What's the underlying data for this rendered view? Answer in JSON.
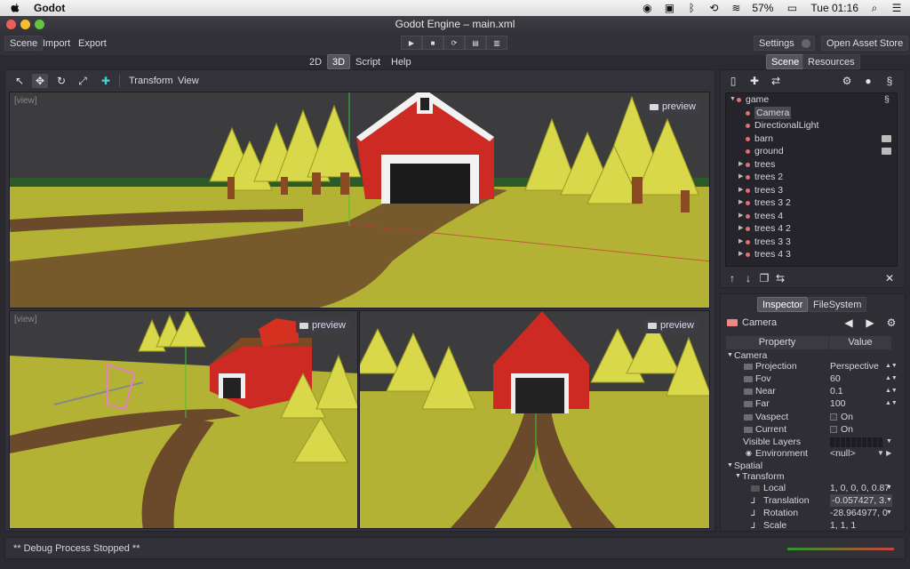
{
  "menubar": {
    "app_name": "Godot",
    "battery": "57%",
    "clock": "Tue 01:16"
  },
  "window": {
    "title": "Godot Engine – main.xml"
  },
  "topbar": {
    "scene": "Scene",
    "import": "Import",
    "export": "Export",
    "settings": "Settings",
    "asset_store": "Open Asset Store"
  },
  "mode_tabs": {
    "d2": "2D",
    "d3": "3D",
    "script": "Script",
    "help": "Help"
  },
  "vtoolbar": {
    "transform": "Transform",
    "view": "View"
  },
  "viewports": {
    "label": "[view]",
    "preview": "preview"
  },
  "scene_panel": {
    "tab_scene": "Scene",
    "tab_resources": "Resources",
    "nodes": [
      {
        "label": "game",
        "level": 0,
        "expand": "▼"
      },
      {
        "label": "Camera",
        "level": 1,
        "selected": true
      },
      {
        "label": "DirectionalLight",
        "level": 1
      },
      {
        "label": "barn",
        "level": 1
      },
      {
        "label": "ground",
        "level": 1
      },
      {
        "label": "trees",
        "level": 1,
        "expand": "▶"
      },
      {
        "label": "trees 2",
        "level": 1,
        "expand": "▶"
      },
      {
        "label": "trees 3",
        "level": 1,
        "expand": "▶"
      },
      {
        "label": "trees 3 2",
        "level": 1,
        "expand": "▶"
      },
      {
        "label": "trees 4",
        "level": 1,
        "expand": "▶"
      },
      {
        "label": "trees 4 2",
        "level": 1,
        "expand": "▶"
      },
      {
        "label": "trees 3 3",
        "level": 1,
        "expand": "▶"
      },
      {
        "label": "trees 4 3",
        "level": 1,
        "expand": "▶"
      }
    ]
  },
  "inspector": {
    "tab_inspector": "Inspector",
    "tab_filesystem": "FileSystem",
    "object": "Camera",
    "col_property": "Property",
    "col_value": "Value",
    "section_camera": "Camera",
    "projection": {
      "name": "Projection",
      "value": "Perspective"
    },
    "fov": {
      "name": "Fov",
      "value": "60"
    },
    "near": {
      "name": "Near",
      "value": "0.1"
    },
    "far": {
      "name": "Far",
      "value": "100"
    },
    "vaspect": {
      "name": "Vaspect",
      "value": "On"
    },
    "current": {
      "name": "Current",
      "value": "On"
    },
    "visible_layers": {
      "name": "Visible Layers"
    },
    "environment": {
      "name": "Environment",
      "value": "<null>"
    },
    "section_spatial": "Spatial",
    "section_transform": "Transform",
    "local": {
      "name": "Local",
      "value": "1, 0, 0, 0, 0.87"
    },
    "translation": {
      "name": "Translation",
      "value": "-0.057427, 3."
    },
    "rotation": {
      "name": "Rotation",
      "value": "-28.964977, 0"
    },
    "scale": {
      "name": "Scale",
      "value": "1, 1, 1"
    }
  },
  "status": {
    "text": "** Debug Process Stopped **"
  },
  "colors": {
    "accent": "#e36f6f",
    "grass": "#b4b234",
    "panel": "#2f2e35"
  }
}
